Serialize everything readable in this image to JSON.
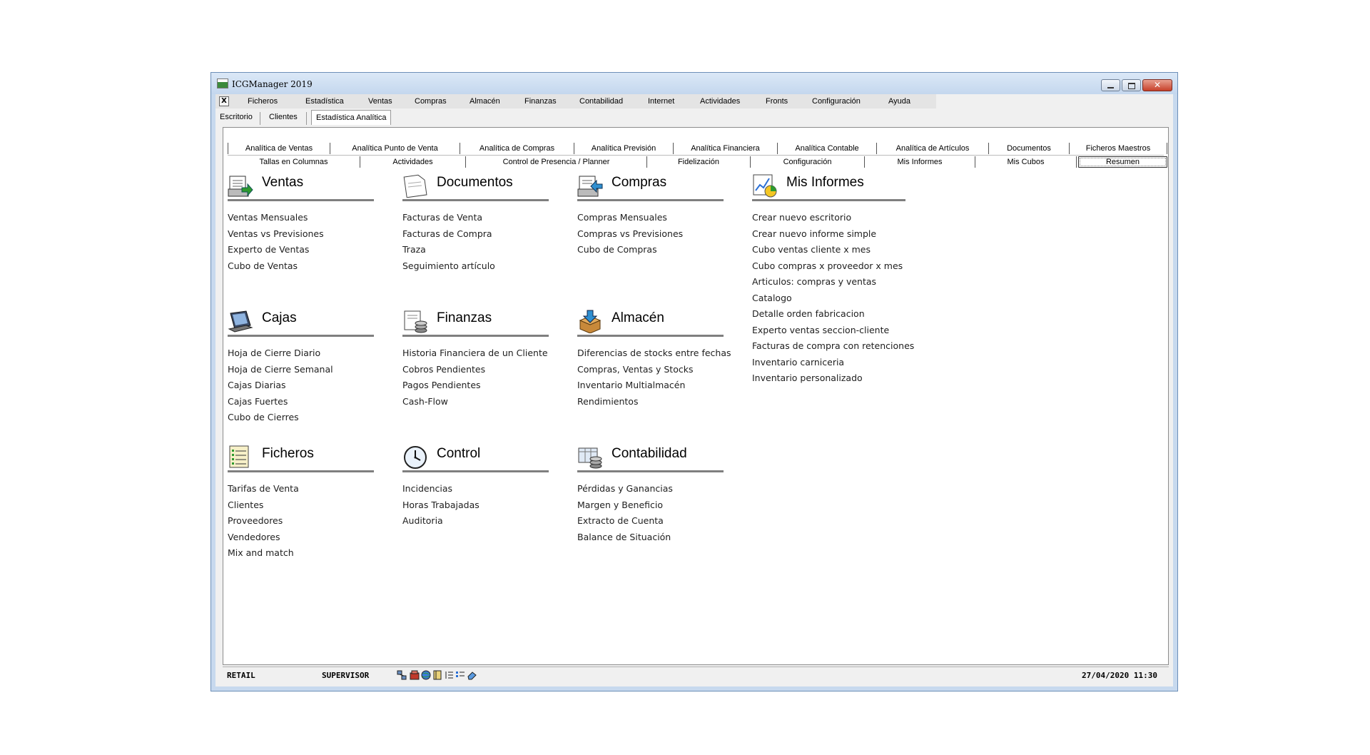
{
  "window": {
    "title": "ICGManager 2019",
    "close_glyph": "✕",
    "mdi_close_glyph": "X"
  },
  "menu": [
    "Ficheros",
    "Estadística",
    "Ventas",
    "Compras",
    "Almacén",
    "Finanzas",
    "Contabilidad",
    "Internet",
    "Actividades",
    "Fronts",
    "Configuración",
    "Ayuda"
  ],
  "desktop_tabs": [
    "Escritorio",
    "Clientes",
    "Estadística Analítica"
  ],
  "tabs_row1": [
    "Analítica de Ventas",
    "Analítica Punto de Venta",
    "Analítica de Compras",
    "Analítica Previsión",
    "Analítica Financiera",
    "Analítica Contable",
    "Analítica de Artículos",
    "Documentos",
    "Ficheros Maestros"
  ],
  "tabs_row2": [
    "Tallas en Columnas",
    "Actividades",
    "Control de Presencia / Planner",
    "Fidelización",
    "Configuración",
    "Mis Informes",
    "Mis Cubos",
    "Resumen"
  ],
  "groups": {
    "ventas": {
      "title": "Ventas",
      "icon": "sales-printer-icon",
      "items": [
        "Ventas Mensuales",
        "Ventas vs Previsiones",
        "Experto de Ventas",
        "Cubo de Ventas"
      ]
    },
    "documentos": {
      "title": "Documentos",
      "icon": "document-icon",
      "items": [
        "Facturas de Venta",
        "Facturas de Compra",
        "Traza",
        "Seguimiento artículo"
      ]
    },
    "compras": {
      "title": "Compras",
      "icon": "purchase-printer-icon",
      "items": [
        "Compras Mensuales",
        "Compras vs Previsiones",
        "Cubo de Compras"
      ]
    },
    "mis_informes": {
      "title": "Mis Informes",
      "icon": "report-chart-icon",
      "items": [
        "Crear nuevo escritorio",
        "Crear nuevo informe simple",
        "Cubo ventas cliente x mes",
        "Cubo compras x proveedor x mes",
        "Articulos: compras y ventas",
        "Catalogo",
        "Detalle orden fabricacion",
        "Experto ventas seccion-cliente",
        "Facturas de compra con retenciones",
        "Inventario carniceria",
        "Inventario personalizado"
      ]
    },
    "cajas": {
      "title": "Cajas",
      "icon": "pos-terminal-icon",
      "items": [
        "Hoja de Cierre Diario",
        "Hoja de Cierre Semanal",
        "Cajas Diarias",
        "Cajas Fuertes",
        "Cubo de Cierres"
      ]
    },
    "finanzas": {
      "title": "Finanzas",
      "icon": "finance-coins-icon",
      "items": [
        "Historia Financiera de un Cliente",
        "Cobros Pendientes",
        "Pagos Pendientes",
        "Cash-Flow"
      ]
    },
    "almacen": {
      "title": "Almacén",
      "icon": "warehouse-box-icon",
      "items": [
        "Diferencias de stocks entre fechas",
        "Compras, Ventas y Stocks",
        "Inventario Multialmacén",
        "Rendimientos"
      ]
    },
    "ficheros": {
      "title": "Ficheros",
      "icon": "files-list-icon",
      "items": [
        "Tarifas de Venta",
        "Clientes",
        "Proveedores",
        "Vendedores",
        "Mix and match"
      ]
    },
    "control": {
      "title": "Control",
      "icon": "clock-icon",
      "items": [
        "Incidencias",
        "Horas Trabajadas",
        "Auditoria"
      ]
    },
    "contabilidad": {
      "title": "Contabilidad",
      "icon": "accounting-icon",
      "items": [
        "Pérdidas y Ganancias",
        "Margen y Beneficio",
        "Extracto de Cuenta",
        "Balance de Situación"
      ]
    }
  },
  "status": {
    "company": "RETAIL",
    "user": "SUPERVISOR",
    "datetime": "27/04/2020 11:30"
  }
}
